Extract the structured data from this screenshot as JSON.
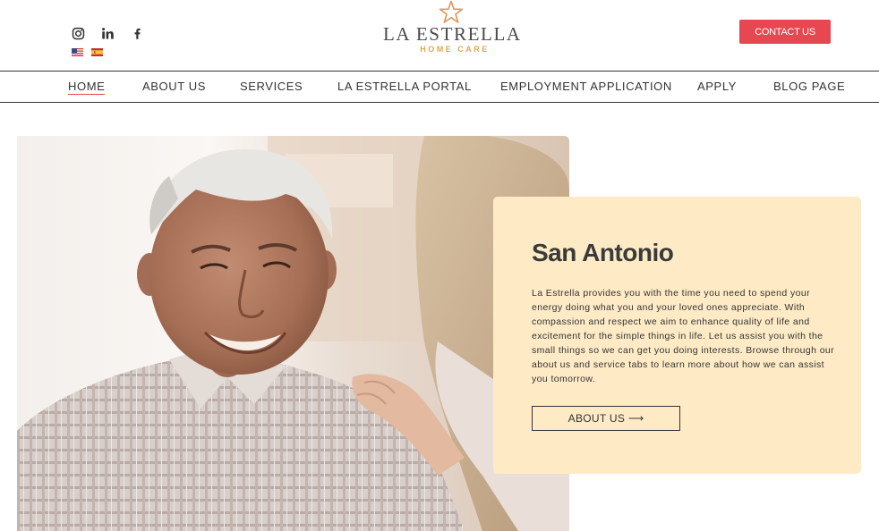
{
  "header": {
    "social": [
      {
        "icon": "instagram-icon"
      },
      {
        "icon": "linkedin-icon"
      },
      {
        "icon": "facebook-icon"
      }
    ],
    "languages": [
      {
        "icon": "us-flag-icon"
      },
      {
        "icon": "spain-flag-icon"
      }
    ],
    "logo": {
      "name": "LA ESTRELLA",
      "subtitle": "HOME CARE"
    },
    "contact_label": "CONTACT US"
  },
  "nav": {
    "items": [
      {
        "label": "HOME",
        "active": true
      },
      {
        "label": "ABOUT US"
      },
      {
        "label": "SERVICES"
      },
      {
        "label": "LA ESTRELLA PORTAL"
      },
      {
        "label": "EMPLOYMENT APPLICATION"
      },
      {
        "label": "APPLY"
      },
      {
        "label": "BLOG PAGE"
      }
    ]
  },
  "hero": {
    "title": "San Antonio",
    "body": "La Estrella provides you with the time you need to spend your energy doing what you and your loved ones appreciate. With compassion and respect we aim to enhance quality of life and excitement for the simple things in life. Let us assist you with the small things so we can get you doing interests. Browse through our about us and service tabs to learn more about how we can assist you tomorrow.",
    "button_label": "ABOUT US ⟶"
  },
  "colors": {
    "accent": "#e64750",
    "logo_gold": "#e0a94e",
    "card_bg": "#feebc6",
    "text": "#333333"
  }
}
